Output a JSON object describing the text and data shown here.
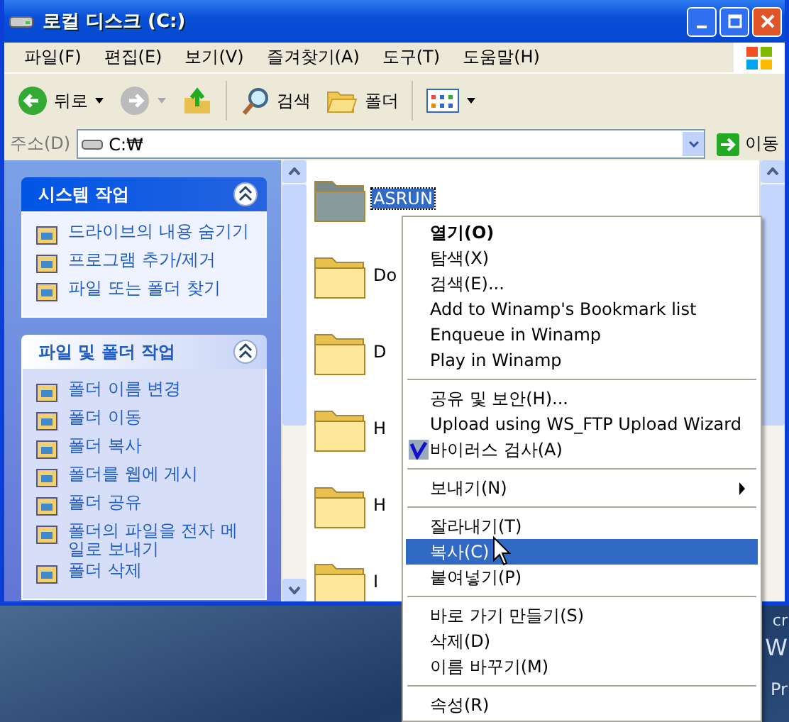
{
  "window": {
    "title": "로컬 디스크 (C:)"
  },
  "menu_bar": [
    "파일(F)",
    "편집(E)",
    "보기(V)",
    "즐겨찾기(A)",
    "도구(T)",
    "도움말(H)"
  ],
  "toolbar": {
    "back": "뒤로",
    "search": "검색",
    "folders": "폴더"
  },
  "address_bar": {
    "label": "주소(D)",
    "value": "C:₩",
    "go": "이동"
  },
  "task_panels": [
    {
      "title": "시스템 작업",
      "kind": "dark",
      "items": [
        "드라이브의 내용 숨기기",
        "프로그램 추가/제거",
        "파일 또는 폴더 찾기"
      ]
    },
    {
      "title": "파일 및 폴더 작업",
      "kind": "light",
      "items": [
        "폴더 이름 변경",
        "폴더 이동",
        "폴더 복사",
        "폴더를 웹에 게시",
        "폴더 공유",
        "폴더의 파일을 전자 메일로 보내기",
        "폴더 삭제"
      ]
    }
  ],
  "files": [
    {
      "name": "ASRUN",
      "selected": true
    },
    {
      "name": "Do",
      "selected": false
    },
    {
      "name": "D",
      "selected": false
    },
    {
      "name": "H",
      "selected": false
    },
    {
      "name": "H",
      "selected": false
    },
    {
      "name": "I",
      "selected": false
    }
  ],
  "context_menu": [
    {
      "kind": "item",
      "label": "열기(O)",
      "default": true,
      "selected": false
    },
    {
      "kind": "item",
      "label": "탐색(X)",
      "selected": false
    },
    {
      "kind": "item",
      "label": "검색(E)...",
      "selected": false
    },
    {
      "kind": "item",
      "label": "Add to Winamp's Bookmark list",
      "selected": false
    },
    {
      "kind": "item",
      "label": "Enqueue in Winamp",
      "selected": false
    },
    {
      "kind": "item",
      "label": "Play in Winamp",
      "selected": false
    },
    {
      "kind": "separator"
    },
    {
      "kind": "item",
      "label": "공유 및 보안(H)...",
      "selected": false
    },
    {
      "kind": "item",
      "label": "Upload using WS_FTP Upload Wizard",
      "selected": false
    },
    {
      "kind": "item",
      "label": "바이러스 검사(A)",
      "has_icon": true,
      "selected": false
    },
    {
      "kind": "separator"
    },
    {
      "kind": "item",
      "label": "보내기(N)",
      "submenu": true,
      "selected": false
    },
    {
      "kind": "separator"
    },
    {
      "kind": "item",
      "label": "잘라내기(T)",
      "selected": false
    },
    {
      "kind": "item",
      "label": "복사(C)",
      "selected": true
    },
    {
      "kind": "item",
      "label": "붙여넣기(P)",
      "selected": false
    },
    {
      "kind": "separator"
    },
    {
      "kind": "item",
      "label": "바로 가기 만들기(S)",
      "selected": false
    },
    {
      "kind": "item",
      "label": "삭제(D)",
      "selected": false
    },
    {
      "kind": "item",
      "label": "이름 바꾸기(M)",
      "selected": false
    },
    {
      "kind": "separator"
    },
    {
      "kind": "item",
      "label": "속성(R)",
      "selected": false
    }
  ],
  "desktop": {
    "logo_fragments": [
      "cr",
      "W",
      "Pr"
    ]
  }
}
